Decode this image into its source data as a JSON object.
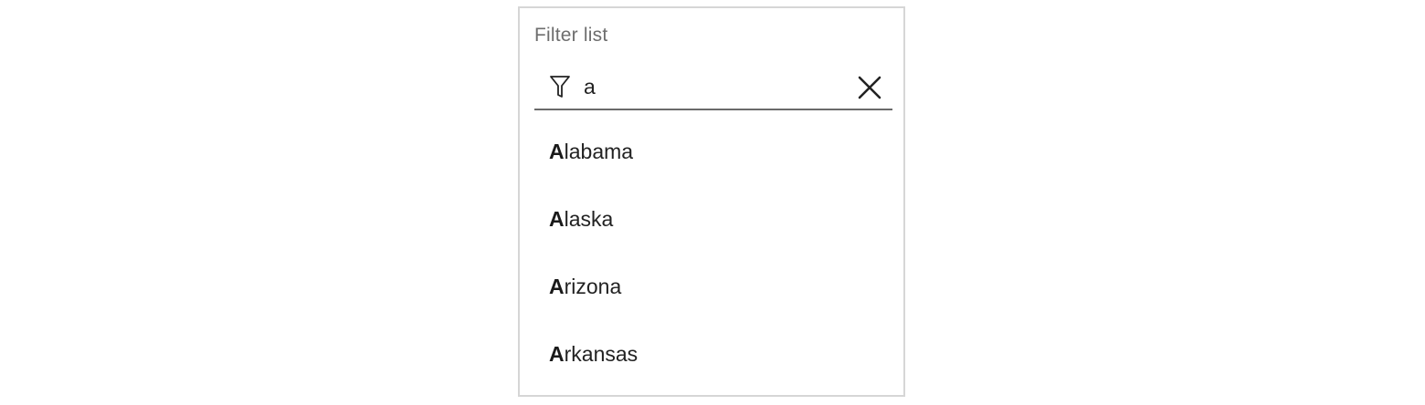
{
  "filter": {
    "label": "Filter list",
    "value": "a",
    "icon": "filter-icon",
    "clear_icon": "close-icon"
  },
  "results": [
    {
      "match": "A",
      "rest": "labama"
    },
    {
      "match": "A",
      "rest": "laska"
    },
    {
      "match": "A",
      "rest": "rizona"
    },
    {
      "match": "A",
      "rest": "rkansas"
    }
  ],
  "colors": {
    "panel_border": "#d6d6d6",
    "label_text": "#6e6e6e",
    "underline": "#6b6b6b",
    "item_text": "#222222"
  }
}
